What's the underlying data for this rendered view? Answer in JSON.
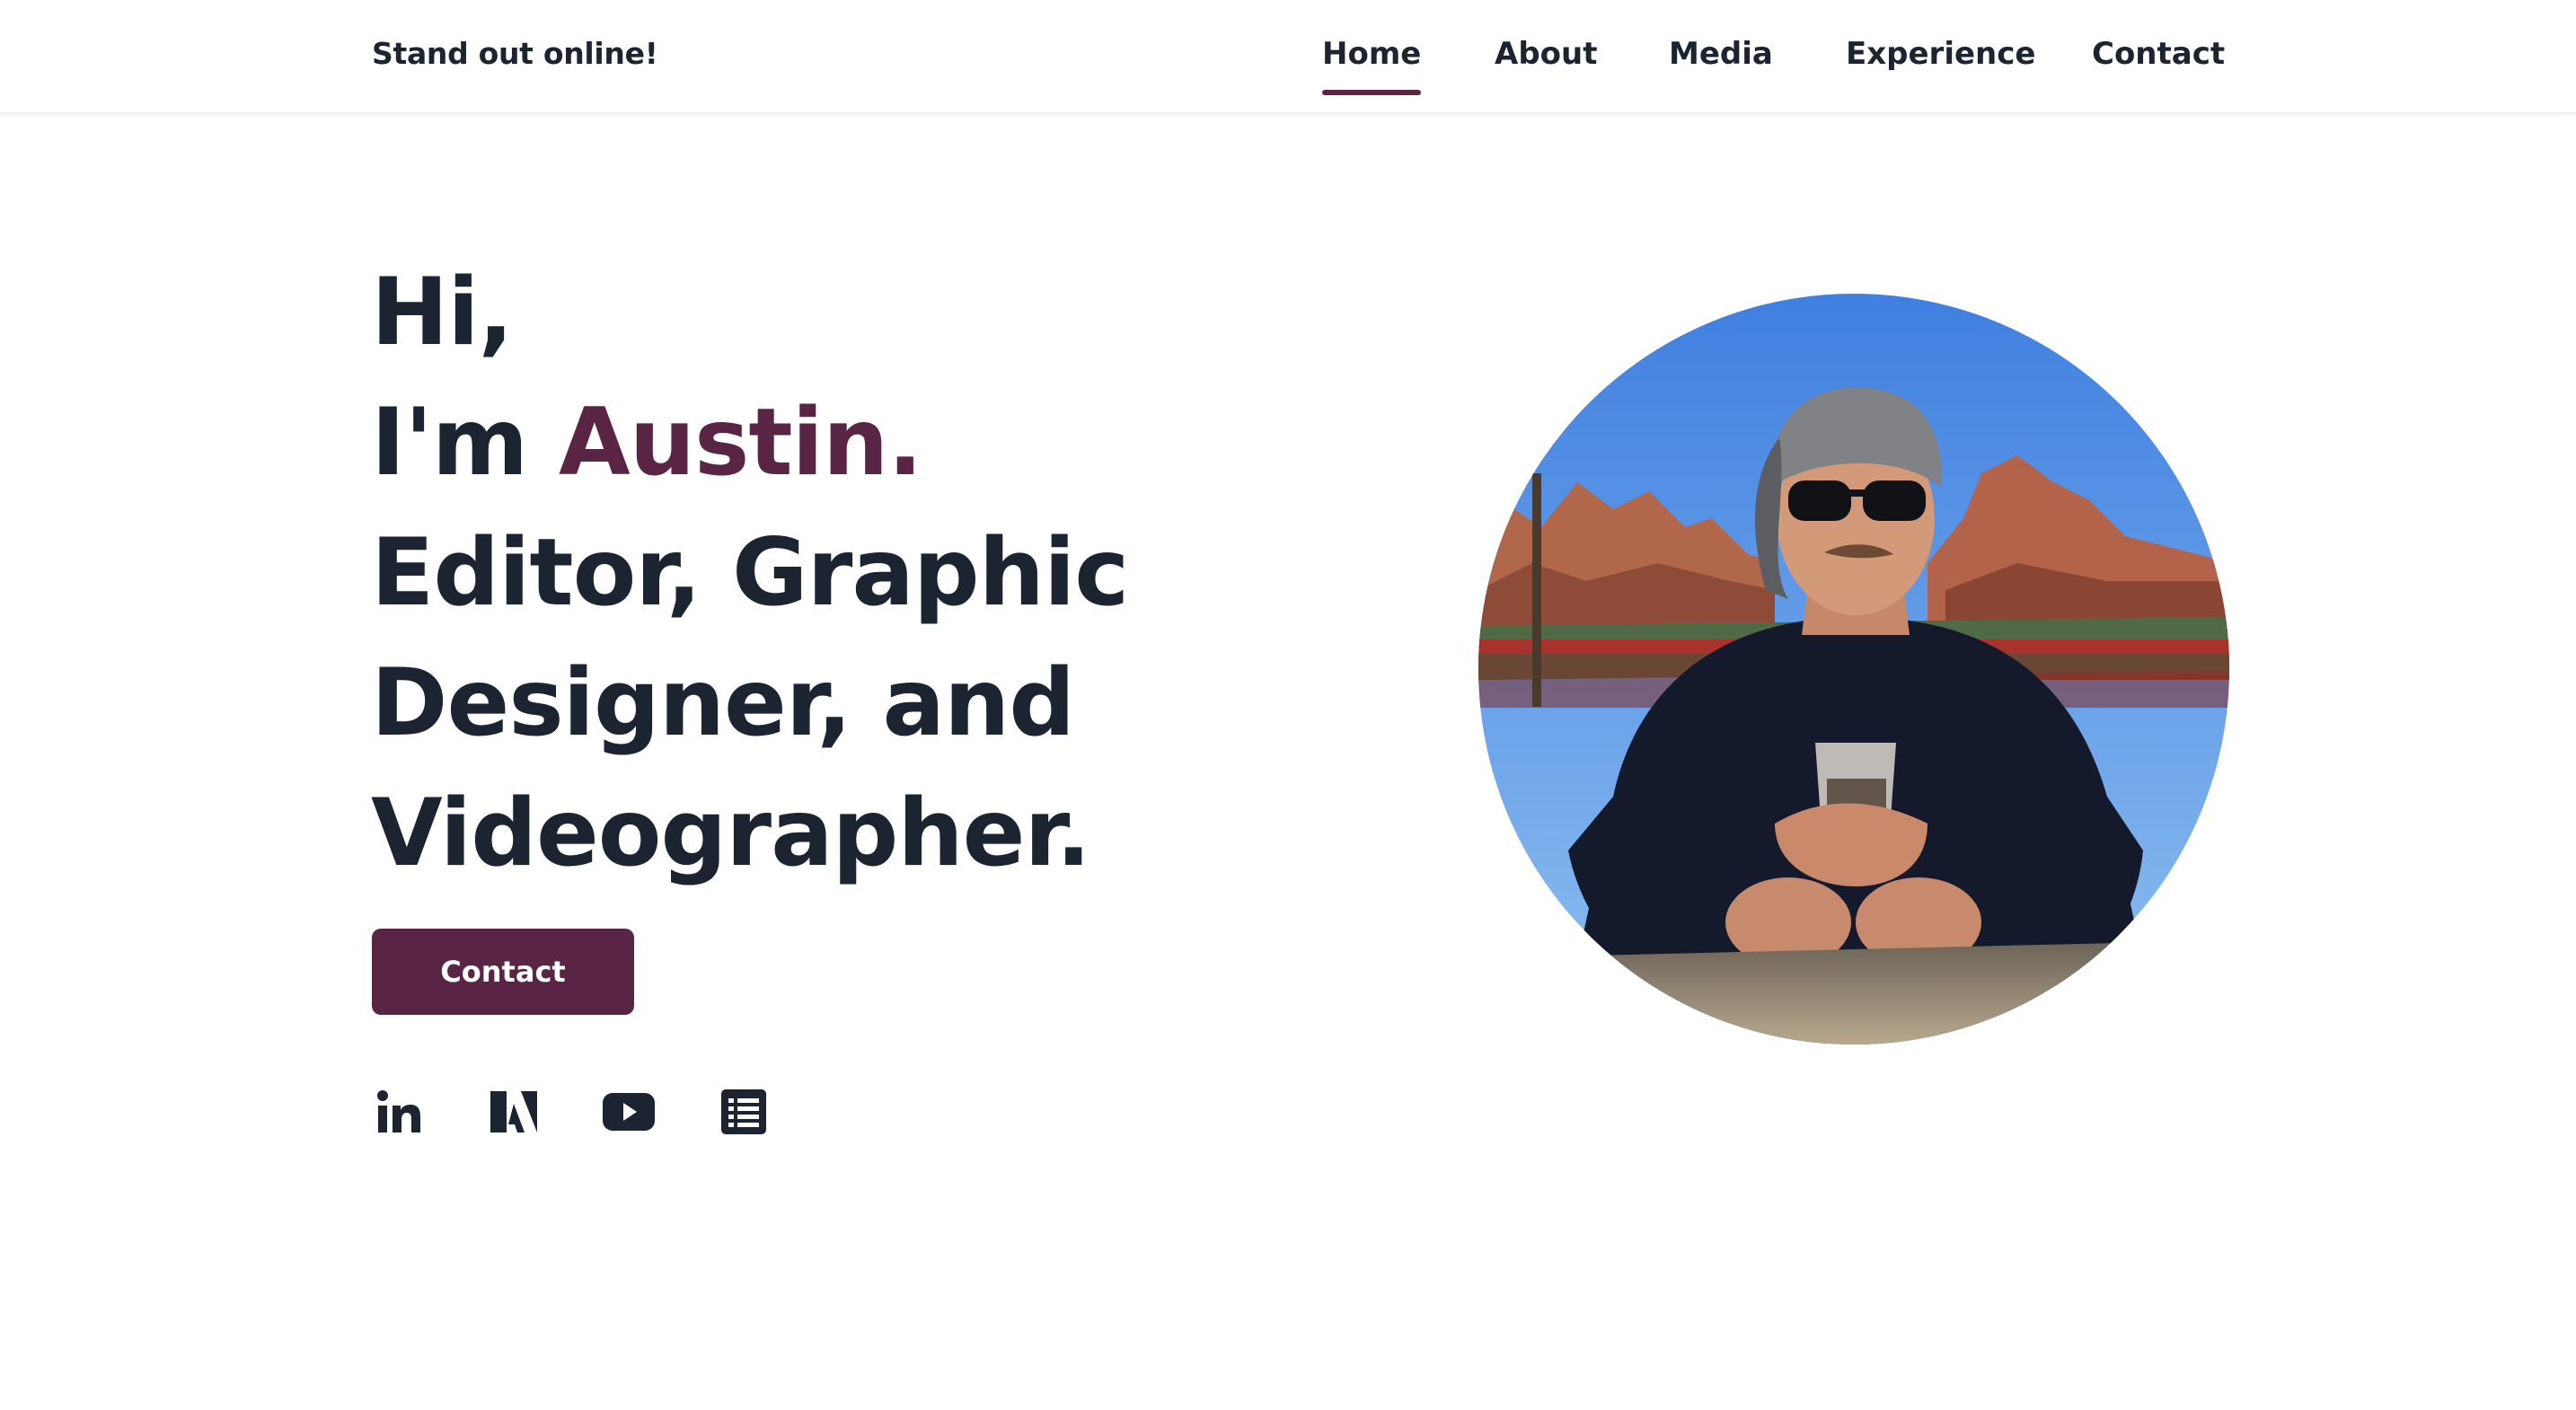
{
  "header": {
    "brand": "Stand out online!",
    "nav": [
      {
        "label": "Home",
        "active": true
      },
      {
        "label": "About",
        "active": false
      },
      {
        "label": "Media",
        "active": false
      },
      {
        "label": "Experience",
        "active": false
      },
      {
        "label": "Contact",
        "active": false
      }
    ]
  },
  "hero": {
    "line1": "Hi,",
    "line2_prefix": "I'm ",
    "name": "Austin.",
    "line3": "Editor, Graphic",
    "line4": "Designer, and",
    "line5": "Videographer.",
    "cta_label": "Contact"
  },
  "socials": [
    {
      "icon": "linkedin-icon"
    },
    {
      "icon": "adobe-icon"
    },
    {
      "icon": "youtube-icon"
    },
    {
      "icon": "resume-list-icon"
    }
  ],
  "colors": {
    "accent": "#5a2545",
    "text": "#1b2430",
    "background": "#ffffff"
  }
}
